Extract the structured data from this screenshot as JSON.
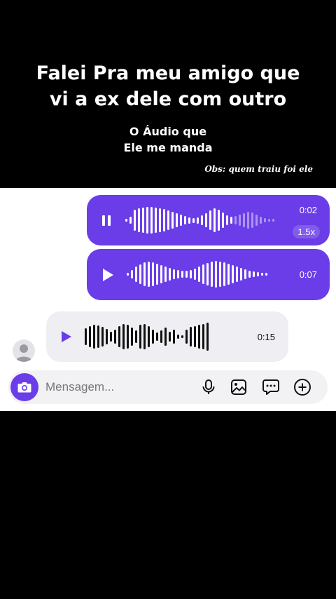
{
  "caption": {
    "title_line1": "Falei Pra meu amigo que",
    "title_line2": "vi a ex dele com outro",
    "subtitle_line1": "O Áudio que",
    "subtitle_line2": "Ele me manda",
    "note": "Obs: quem traiu foi ele"
  },
  "messages": [
    {
      "kind": "sent",
      "state": "playing",
      "duration": "0:02",
      "speed": "1.5x",
      "progress": 0.72
    },
    {
      "kind": "sent",
      "state": "paused",
      "duration": "0:07"
    },
    {
      "kind": "received",
      "state": "paused",
      "duration": "0:15"
    }
  ],
  "composer": {
    "placeholder": "Mensagem...",
    "icons": [
      "camera-icon",
      "microphone-icon",
      "gallery-icon",
      "sticker-chat-icon",
      "add-icon"
    ]
  },
  "colors": {
    "accent": "#6a3de8",
    "received_bubble": "#efeff3",
    "caption_background": "#000000",
    "chat_background": "#ffffff"
  }
}
